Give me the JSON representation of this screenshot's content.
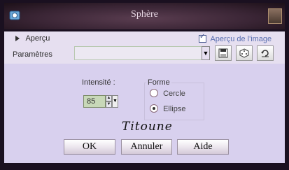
{
  "window": {
    "title": "Sphère"
  },
  "toolbar": {
    "apercu_label": "Aperçu",
    "apercu_image_label": "Aperçu de l'image",
    "parametres_label": "Paramètres",
    "preset_value": ""
  },
  "settings": {
    "intensite_label": "Intensité :",
    "intensite_value": "85",
    "forme_label": "Forme",
    "forme_options": [
      "Cercle",
      "Ellipse"
    ],
    "forme_selected": "Ellipse"
  },
  "signature": "Titoune",
  "buttons": {
    "ok": "OK",
    "annuler": "Annuler",
    "aide": "Aide"
  }
}
